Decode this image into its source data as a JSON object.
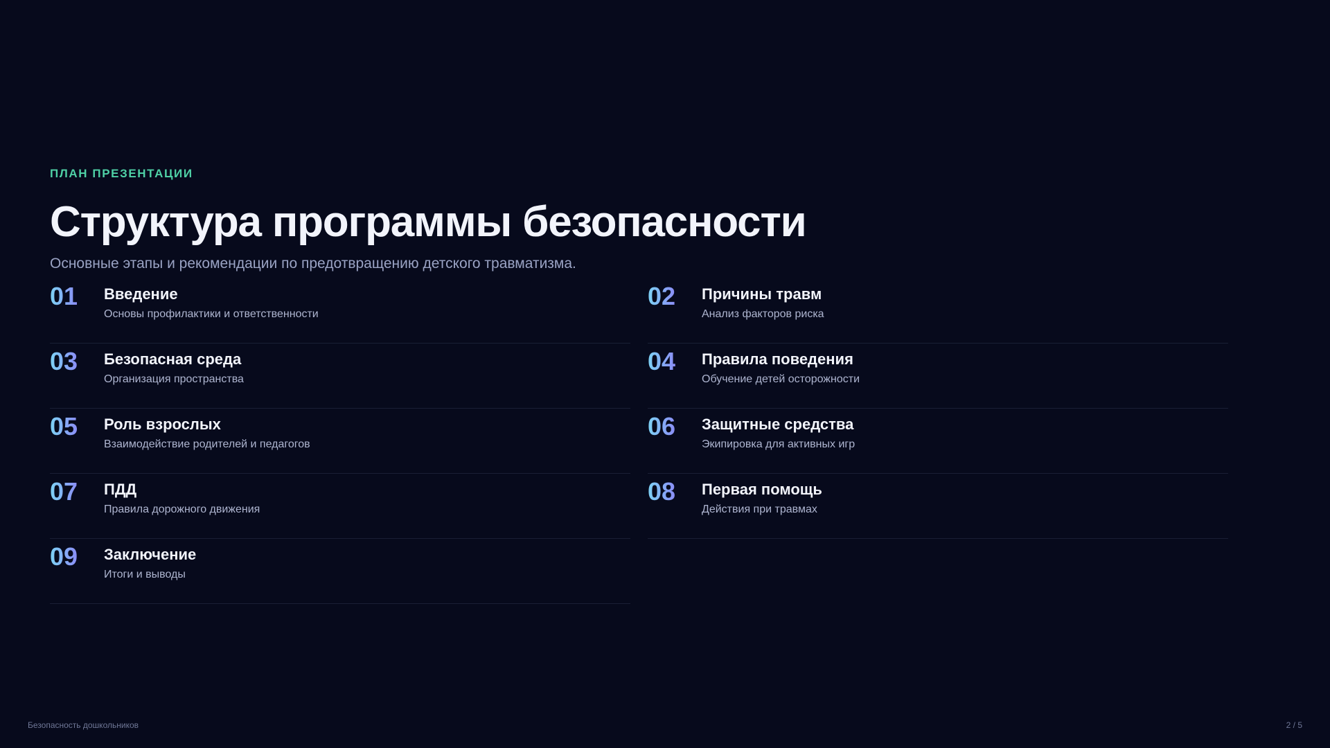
{
  "eyebrow": "ПЛАН ПРЕЗЕНТАЦИИ",
  "title": "Структура программы безопасности",
  "subtitle": "Основные этапы и рекомендации по предотвращению детского травматизма.",
  "items": [
    {
      "num": "01",
      "title": "Введение",
      "desc": "Основы профилактики и ответственности"
    },
    {
      "num": "02",
      "title": "Причины травм",
      "desc": "Анализ факторов риска"
    },
    {
      "num": "03",
      "title": "Безопасная среда",
      "desc": "Организация пространства"
    },
    {
      "num": "04",
      "title": "Правила поведения",
      "desc": "Обучение детей осторожности"
    },
    {
      "num": "05",
      "title": "Роль взрослых",
      "desc": "Взаимодействие родителей и педагогов"
    },
    {
      "num": "06",
      "title": "Защитные средства",
      "desc": "Экипировка для активных игр"
    },
    {
      "num": "07",
      "title": "ПДД",
      "desc": "Правила дорожного движения"
    },
    {
      "num": "08",
      "title": "Первая помощь",
      "desc": "Действия при травмах"
    },
    {
      "num": "09",
      "title": "Заключение",
      "desc": "Итоги и выводы"
    }
  ],
  "footer": {
    "left": "Безопасность дошкольников",
    "page": "2 / 5"
  },
  "colors": {
    "background": "#070a1c",
    "accent": "#4fd1a6",
    "number_gradient_start": "#7dd3f5",
    "number_gradient_end": "#8b8cf6"
  }
}
